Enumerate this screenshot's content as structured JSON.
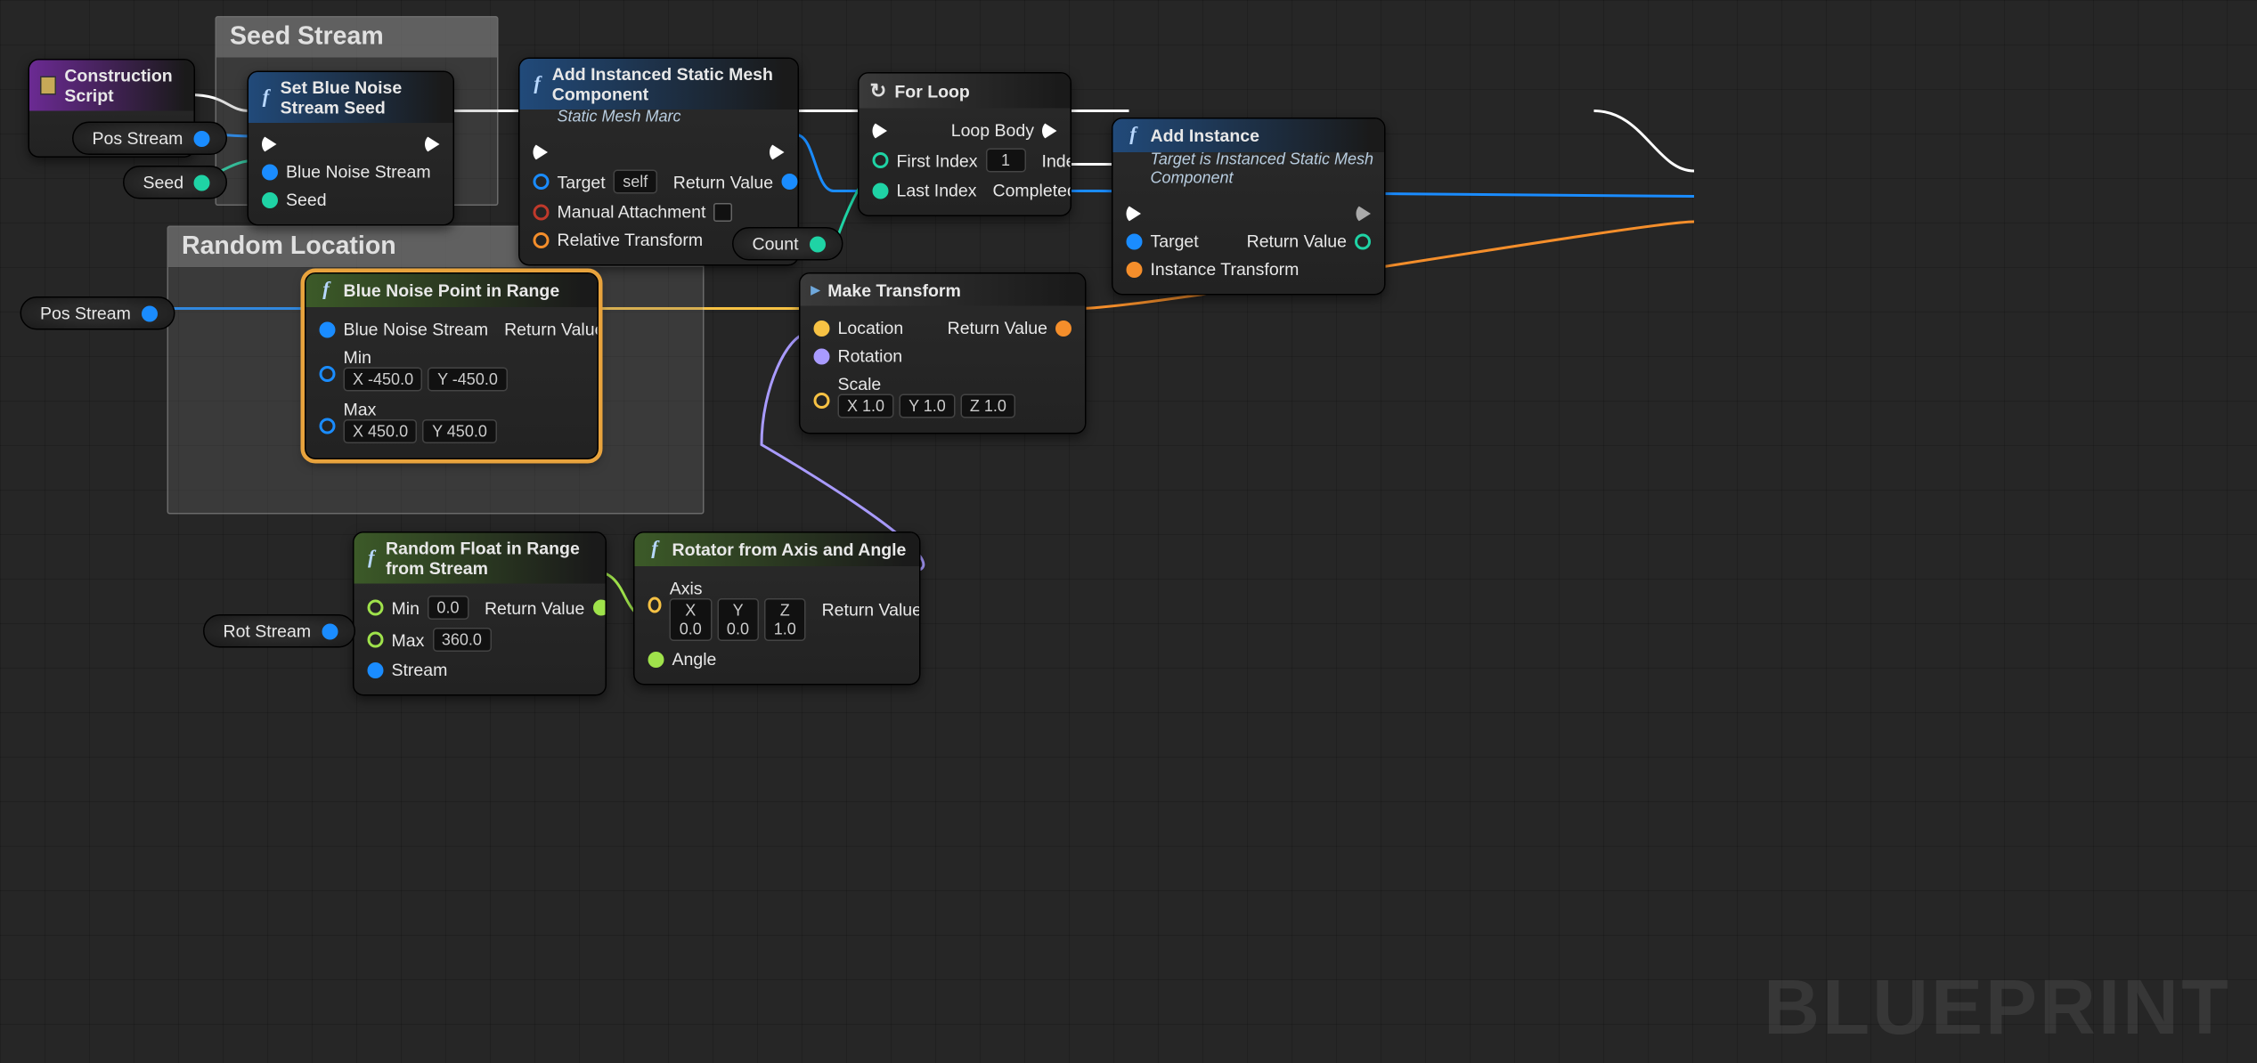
{
  "watermark": "BLUEPRINT",
  "comments": {
    "seed_stream": "Seed Stream",
    "random_location": "Random Location"
  },
  "vars": {
    "pos_stream": "Pos Stream",
    "seed": "Seed",
    "pos_stream2": "Pos Stream",
    "count": "Count",
    "rot_stream": "Rot Stream"
  },
  "nodes": {
    "construction": {
      "title": "Construction Script"
    },
    "set_seed": {
      "title": "Set Blue Noise Stream Seed",
      "in_stream": "Blue Noise Stream",
      "in_seed": "Seed"
    },
    "add_mesh": {
      "title": "Add Instanced Static Mesh Component",
      "subtitle": "Static Mesh Marc",
      "target": "Target",
      "target_val": "self",
      "manual": "Manual Attachment",
      "rel": "Relative Transform",
      "ret": "Return Value"
    },
    "for_loop": {
      "title": "For Loop",
      "first": "First Index",
      "first_val": "1",
      "last": "Last Index",
      "body": "Loop Body",
      "index": "Index",
      "completed": "Completed"
    },
    "add_instance": {
      "title": "Add Instance",
      "subtitle": "Target is Instanced Static Mesh Component",
      "target": "Target",
      "transform": "Instance Transform",
      "ret": "Return Value"
    },
    "blue_noise_point": {
      "title": "Blue Noise Point in Range",
      "in_stream": "Blue Noise Stream",
      "min": "Min",
      "min_x": "-450.0",
      "min_y": "-450.0",
      "max": "Max",
      "max_x": "450.0",
      "max_y": "450.0",
      "ret": "Return Value"
    },
    "make_transform": {
      "title": "Make Transform",
      "loc": "Location",
      "rot": "Rotation",
      "scale": "Scale",
      "sx": "1.0",
      "sy": "1.0",
      "sz": "1.0",
      "ret": "Return Value"
    },
    "rand_float": {
      "title": "Random Float in Range from Stream",
      "min": "Min",
      "min_v": "0.0",
      "max": "Max",
      "max_v": "360.0",
      "stream": "Stream",
      "ret": "Return Value"
    },
    "rotator": {
      "title": "Rotator from Axis and Angle",
      "axis": "Axis",
      "ax": "0.0",
      "ay": "0.0",
      "az": "1.0",
      "angle": "Angle",
      "ret": "Return Value"
    }
  },
  "vec_labels": {
    "x": "X",
    "y": "Y",
    "z": "Z"
  }
}
